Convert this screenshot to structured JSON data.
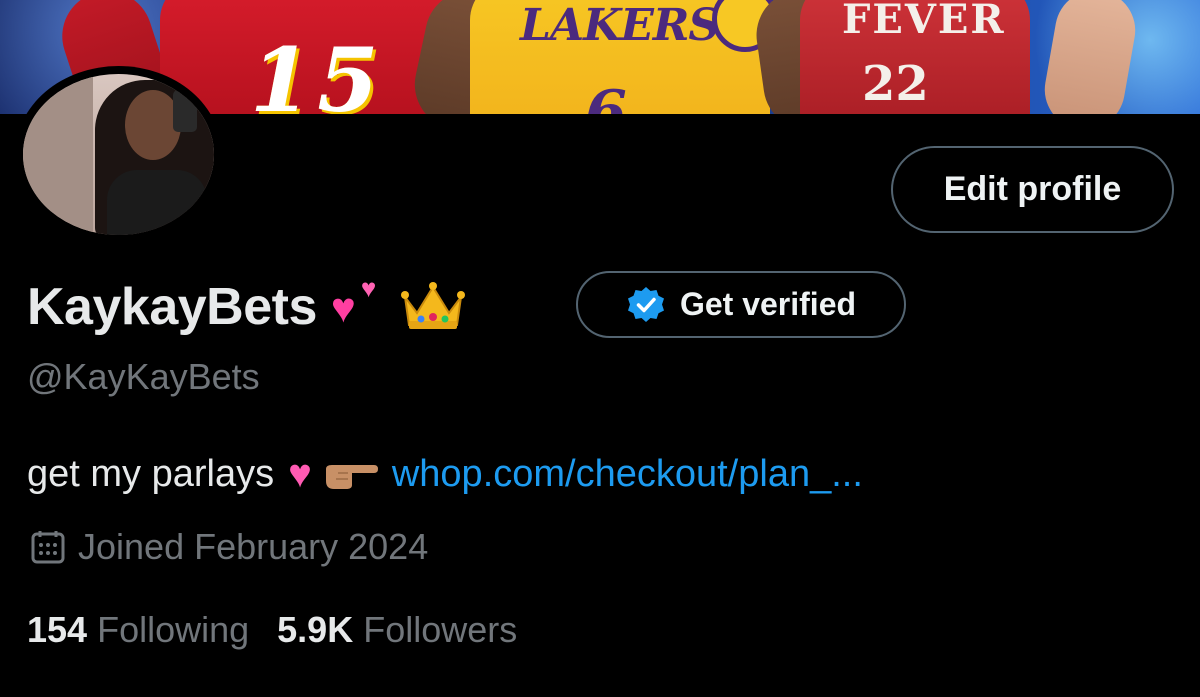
{
  "banner": {
    "jersey_left_number": "15",
    "jersey_middle_team": "LAKERS",
    "jersey_middle_number": "6",
    "jersey_right_team": "FEVER",
    "jersey_right_number": "22"
  },
  "profile": {
    "display_name": "KaykayBets",
    "name_emojis": [
      "two-hearts-icon",
      "crown-icon"
    ],
    "handle": "@KayKayBets",
    "edit_profile_label": "Edit profile",
    "get_verified_label": "Get verified",
    "bio_text": "get my parlays",
    "bio_link": "whop.com/checkout/plan_...",
    "joined": "Joined February 2024"
  },
  "stats": {
    "following_count": "154",
    "following_label": "Following",
    "followers_count": "5.9K",
    "followers_label": "Followers"
  },
  "colors": {
    "background": "#000000",
    "primary_text": "#e7e9ea",
    "secondary_text": "#71767b",
    "link": "#1d9bf0",
    "button_border": "#536471",
    "verified_badge": "#1d9bf0"
  }
}
